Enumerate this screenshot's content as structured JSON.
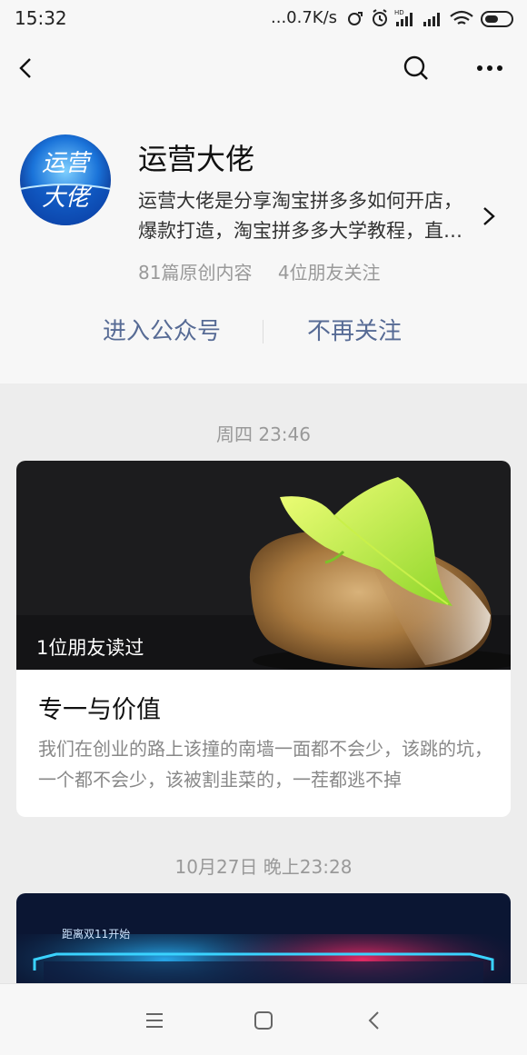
{
  "status_bar": {
    "time": "15:32",
    "network_speed": "...0.7K/s",
    "icons": [
      "sync-icon",
      "alarm-icon",
      "hd-signal-icon",
      "signal-icon",
      "wifi-icon",
      "battery-icon"
    ]
  },
  "nav": {
    "back_icon": "back-arrow-icon",
    "search_icon": "search-icon",
    "more_icon": "more-dots-icon"
  },
  "profile": {
    "avatar_text": "运营大佬",
    "name": "运营大佬",
    "description": "运营大佬是分享淘宝拼多多如何开店，爆款打造，淘宝拼多多大学教程，直…",
    "original_count": "81篇原创内容",
    "friends_follow": "4位朋友关注"
  },
  "actions": {
    "enter_label": "进入公众号",
    "unfollow_label": "不再关注"
  },
  "articles": [
    {
      "date": "周四 23:46",
      "friends_read": "1位朋友读过",
      "title": "专一与价值",
      "digest": "我们在创业的路上该撞的南墙一面都不会少，该跳的坑，一个都不会少，该被割韭菜的，一茬都逃不掉"
    },
    {
      "date": "10月27日 晚上23:28",
      "cover_text": "距离双11开始"
    }
  ],
  "bottom_nav": {
    "menu_icon": "menu-icon",
    "home_icon": "home-square-icon",
    "back_icon": "back-chevron-icon"
  },
  "colors": {
    "link_blue": "#576b95",
    "background": "#ededed",
    "card": "#ffffff",
    "muted_text": "#999999"
  }
}
